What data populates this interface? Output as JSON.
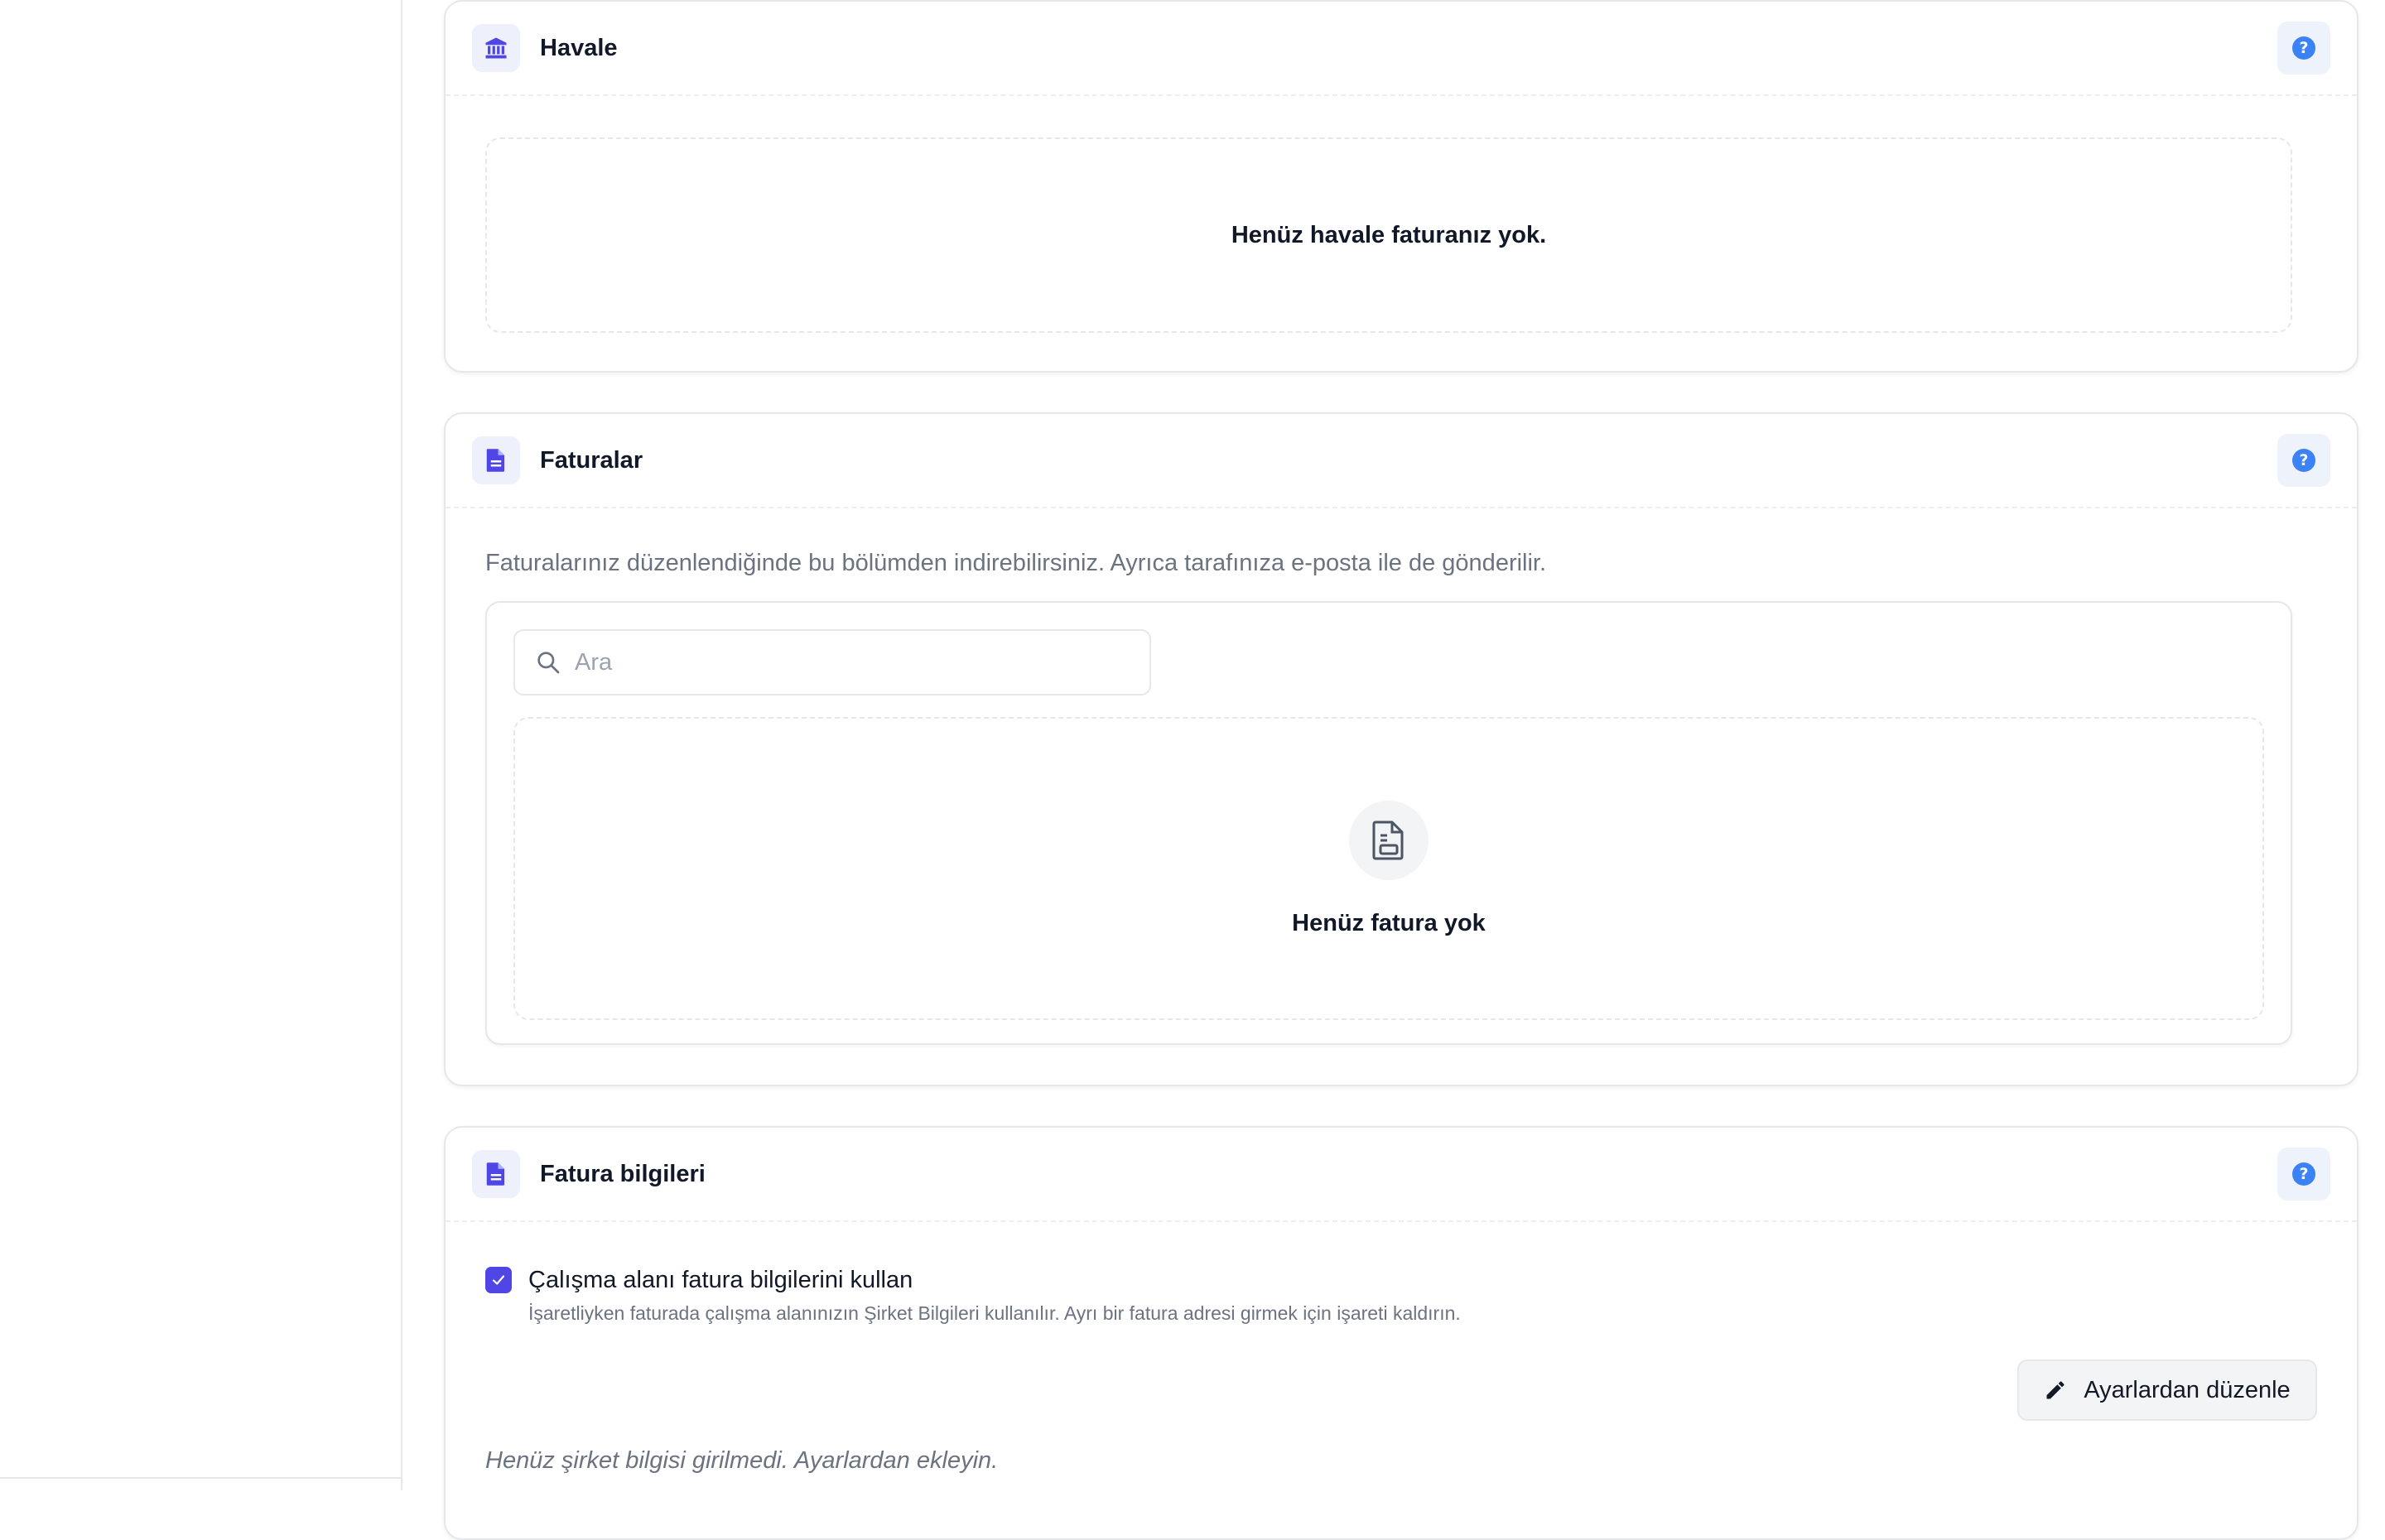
{
  "havale": {
    "title": "Havale",
    "icon": "bank-icon",
    "empty_text": "Henüz havale faturanız yok."
  },
  "faturalar": {
    "title": "Faturalar",
    "icon": "document-icon",
    "description": "Faturalarınız düzenlendiğinde bu bölümden indirebilirsiniz. Ayrıca tarafınıza e-posta ile de gönderilir.",
    "search": {
      "placeholder": "Ara",
      "value": ""
    },
    "empty_title": "Henüz fatura yok"
  },
  "fatura_bilgileri": {
    "title": "Fatura bilgileri",
    "icon": "document-icon",
    "checkbox": {
      "checked": true,
      "label": "Çalışma alanı fatura bilgilerini kullan",
      "hint": "İşaretliyken faturada çalışma alanınızın Şirket Bilgileri kullanılır. Ayrı bir fatura adresi girmek için işareti kaldırın."
    },
    "edit_button": "Ayarlardan düzenle",
    "empty_note": "Henüz şirket bilgisi girilmedi. Ayarlardan ekleyin."
  },
  "help_icon": "?",
  "colors": {
    "accent": "#4f46e5",
    "help": "#3b82f6",
    "border": "#e5e7eb",
    "muted_text": "#6b7280"
  }
}
